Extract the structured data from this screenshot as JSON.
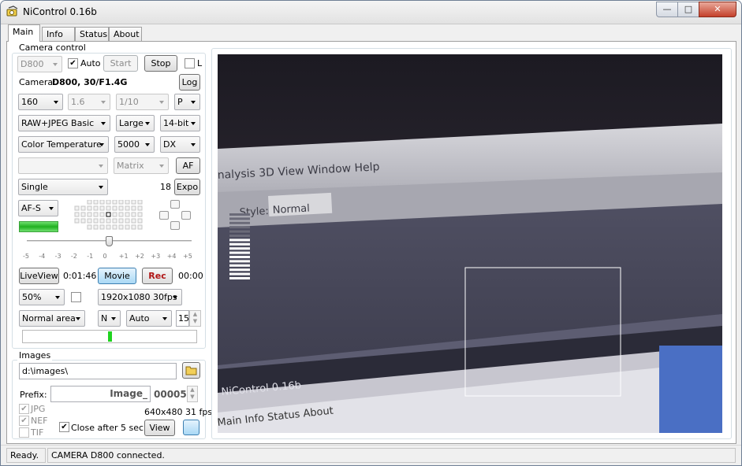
{
  "window": {
    "title": "NiControl 0.16b",
    "minimize": "—",
    "maximize": "□",
    "close": "✕"
  },
  "tabs": [
    "Main",
    "Info",
    "Status",
    "About"
  ],
  "camera_control": {
    "group_label": "Camera control",
    "model_select": "D800",
    "auto_label": "Auto",
    "auto_checked": true,
    "start_label": "Start",
    "stop_label": "Stop",
    "l_label": "L",
    "camera_label": "Camera:",
    "camera_value": "D800, 30/F1.4G",
    "log_label": "Log",
    "iso": "160",
    "aperture": "1.6",
    "shutter": "1/10",
    "mode": "P",
    "quality": "RAW+JPEG Basic",
    "size": "Large",
    "bit_depth": "14-bit",
    "wb": "Color Temperature",
    "wb_value": "5000",
    "crop": "DX",
    "picture_control": "",
    "metering": "Matrix",
    "af_label": "AF",
    "drive": "Single",
    "shots": "18",
    "expo_label": "Expo",
    "af_mode": "AF-S",
    "ev_scale": [
      "-5",
      "-4",
      "-3",
      "-2",
      "-1",
      "0",
      "+1",
      "+2",
      "+3",
      "+4",
      "+5"
    ],
    "liveview_label": "LiveView",
    "time": "0:01:46",
    "movie_label": "Movie",
    "rec_label": "Rec",
    "rec_time": "00:00",
    "zoom": "50%",
    "resolution": "1920x1080 30fps",
    "area": "Normal area",
    "n_select": "N",
    "auto_select": "Auto",
    "spin_value": "15",
    "level_fraction": 0.49
  },
  "images": {
    "group_label": "Images",
    "path": "d:\\images\\",
    "prefix_label": "Prefix:",
    "prefix_value": "Image_",
    "counter": "00005",
    "formats": [
      {
        "label": "JPG",
        "checked": true
      },
      {
        "label": "NEF",
        "checked": true
      },
      {
        "label": "TIF",
        "checked": false
      }
    ],
    "preview_info": "640x480 31 fps",
    "close_after_label": "Close after 5 sec",
    "close_after_checked": true,
    "view_label": "View"
  },
  "preview": {
    "menu": [
      "nalysis",
      "3D",
      "View",
      "Window",
      "Help"
    ],
    "style_label": "Style:",
    "style_value": "Normal",
    "window_title": "NiControl 0.16b",
    "tabs": [
      "Main",
      "Info",
      "Status",
      "About"
    ]
  },
  "status": {
    "left": "Ready.",
    "right": "CAMERA D800 connected."
  }
}
